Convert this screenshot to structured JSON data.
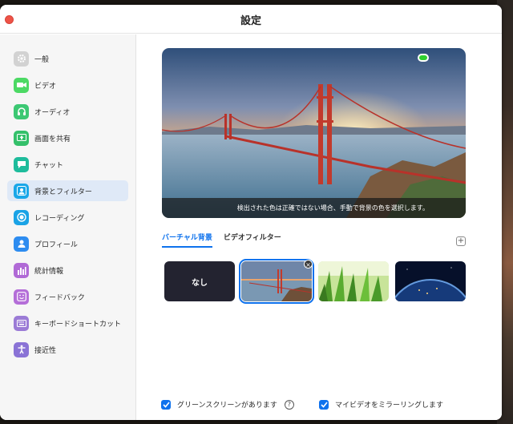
{
  "window": {
    "title": "設定"
  },
  "sidebar": {
    "items": [
      {
        "label": "一般",
        "icon": "gear-icon",
        "color": "#d2d2d2",
        "active": false
      },
      {
        "label": "ビデオ",
        "icon": "video-camera-icon",
        "color": "#4cd964",
        "active": false
      },
      {
        "label": "オーディオ",
        "icon": "headphones-icon",
        "color": "#3cc873",
        "active": false
      },
      {
        "label": "画面を共有",
        "icon": "share-screen-icon",
        "color": "#34c06a",
        "active": false
      },
      {
        "label": "チャット",
        "icon": "chat-bubble-icon",
        "color": "#1ebc9c",
        "active": false
      },
      {
        "label": "背景とフィルター",
        "icon": "background-filter-icon",
        "color": "#1aa7e8",
        "active": true
      },
      {
        "label": "レコーディング",
        "icon": "record-icon",
        "color": "#1aa3e6",
        "active": false
      },
      {
        "label": "プロフィール",
        "icon": "profile-icon",
        "color": "#2d8cf0",
        "active": false
      },
      {
        "label": "統計情報",
        "icon": "statistics-icon",
        "color": "#b06ad6",
        "active": false
      },
      {
        "label": "フィードバック",
        "icon": "feedback-smile-icon",
        "color": "#b46ed8",
        "active": false
      },
      {
        "label": "キーボードショートカット",
        "icon": "keyboard-icon",
        "color": "#9b7bd6",
        "active": false
      },
      {
        "label": "接近性",
        "icon": "accessibility-icon",
        "color": "#8a73d6",
        "active": false
      }
    ]
  },
  "preview": {
    "banner_text": "検出された色は正確ではない場合、手動で背景の色を選択します。",
    "chip_color": "#2fd12f"
  },
  "tabs": [
    {
      "label": "バーチャル背景",
      "active": true
    },
    {
      "label": "ビデオフィルター",
      "active": false
    }
  ],
  "backgrounds": [
    {
      "label": "なし",
      "kind": "none",
      "selected": false
    },
    {
      "kind": "golden-gate-bridge",
      "selected": true
    },
    {
      "kind": "grass",
      "selected": false
    },
    {
      "kind": "earth-from-space",
      "selected": false
    }
  ],
  "footer": {
    "green_screen_label": "グリーンスクリーンがあります",
    "green_screen_checked": true,
    "mirror_label": "マイビデオをミラーリングします",
    "mirror_checked": true
  },
  "colors": {
    "accent": "#0e72ed",
    "close": "#ee5347"
  }
}
